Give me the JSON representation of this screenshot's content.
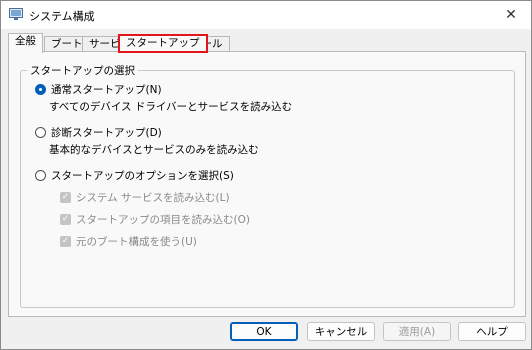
{
  "window": {
    "title": "システム構成"
  },
  "tabs": [
    {
      "label": "全般"
    },
    {
      "label": "ブート"
    },
    {
      "label": "サービス"
    },
    {
      "label": "スタートアップ"
    },
    {
      "label": "ツール"
    }
  ],
  "group": {
    "legend": "スタートアップの選択",
    "normal": {
      "label": "通常スタートアップ(N)",
      "desc": "すべてのデバイス ドライバーとサービスを読み込む",
      "checked": true
    },
    "diagnostic": {
      "label": "診断スタートアップ(D)",
      "desc": "基本的なデバイスとサービスのみを読み込む"
    },
    "selective": {
      "label": "スタートアップのオプションを選択(S)"
    },
    "options": [
      {
        "label": "システム サービスを読み込む(L)"
      },
      {
        "label": "スタートアップの項目を読み込む(O)"
      },
      {
        "label": "元のブート構成を使う(U)"
      }
    ]
  },
  "buttons": {
    "ok": "OK",
    "cancel": "キャンセル",
    "apply": "適用(A)",
    "help": "ヘルプ"
  },
  "colors": {
    "highlight": "#e0161b",
    "accent": "#005fb8"
  }
}
